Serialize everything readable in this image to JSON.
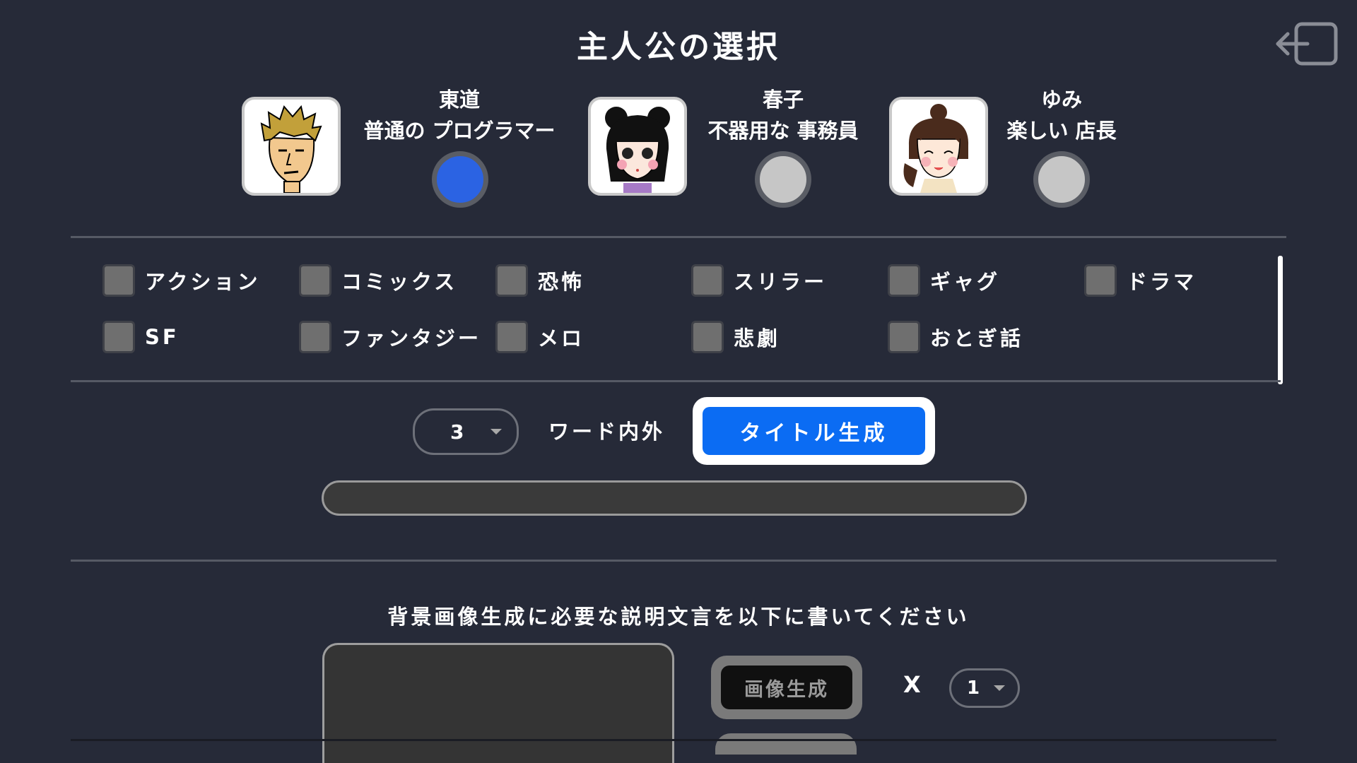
{
  "header": {
    "title": "主人公の選択",
    "exit_icon": "exit-arrow-icon"
  },
  "characters": [
    {
      "name": "東道",
      "role": "普通の プログラマー",
      "selected": true
    },
    {
      "name": "春子",
      "role": "不器用な 事務員",
      "selected": false
    },
    {
      "name": "ゆみ",
      "role": "楽しい 店長",
      "selected": false
    }
  ],
  "genres": [
    {
      "label": "アクション",
      "checked": false
    },
    {
      "label": "コミックス",
      "checked": false
    },
    {
      "label": "恐怖",
      "checked": false
    },
    {
      "label": "スリラー",
      "checked": false
    },
    {
      "label": "ギャグ",
      "checked": false
    },
    {
      "label": "ドラマ",
      "checked": false
    },
    {
      "label": "SF",
      "checked": false
    },
    {
      "label": "ファンタジー",
      "checked": false
    },
    {
      "label": "メロ",
      "checked": false
    },
    {
      "label": "悲劇",
      "checked": false
    },
    {
      "label": "おとぎ話",
      "checked": false
    }
  ],
  "title_gen": {
    "word_count": "3",
    "word_label": "ワード内外",
    "button_label": "タイトル生成",
    "output": ""
  },
  "bg_gen": {
    "prompt_label": "背景画像生成に必要な説明文言を以下に書いてください",
    "prompt_value": "",
    "button_label": "画像生成",
    "times_label": "X",
    "count": "1"
  },
  "colors": {
    "background": "#262a38",
    "accent": "#0b6cf3",
    "radio_selected": "#2b63e3"
  }
}
